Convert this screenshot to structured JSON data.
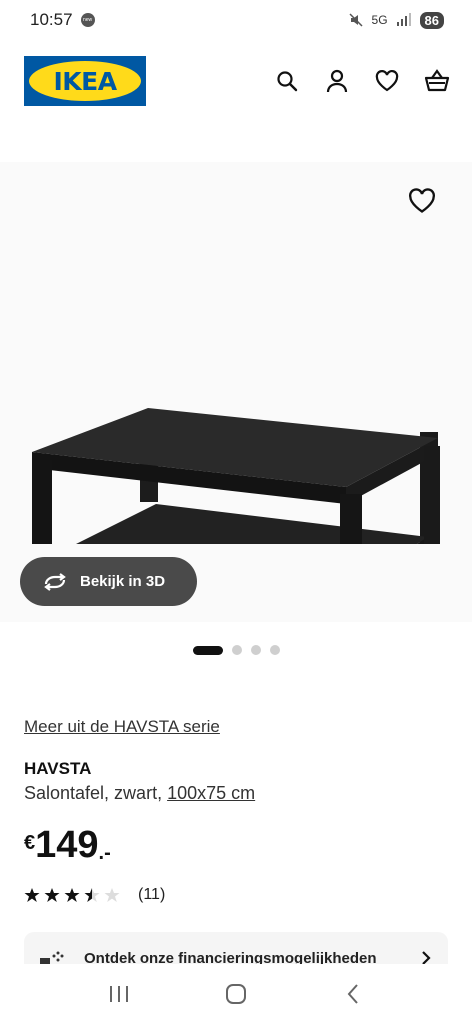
{
  "status": {
    "time": "10:57",
    "badge": "new",
    "network": "5G",
    "battery": "86"
  },
  "header": {
    "logo_text": "IKEA",
    "icons": [
      "search-icon",
      "user-icon",
      "heart-icon",
      "cart-icon"
    ]
  },
  "product": {
    "view3d_label": "Bekijk in 3D",
    "series_link": "Meer uit de HAVSTA serie",
    "name": "HAVSTA",
    "desc_prefix": "Salontafel, zwart,",
    "desc_size": "100x75 cm",
    "price_currency": "€",
    "price_amount": "149",
    "price_suffix": ".-",
    "rating_value": 3.5,
    "rating_max": 5,
    "rating_count": "(11)",
    "gallery_count": 4,
    "gallery_active": 1
  },
  "finance": {
    "label": "Ontdek onze financieringsmogelijkheden"
  },
  "colors": {
    "ikea_blue": "#0058a3",
    "ikea_yellow": "#ffda1a",
    "button_dark": "#4a4a4a"
  }
}
